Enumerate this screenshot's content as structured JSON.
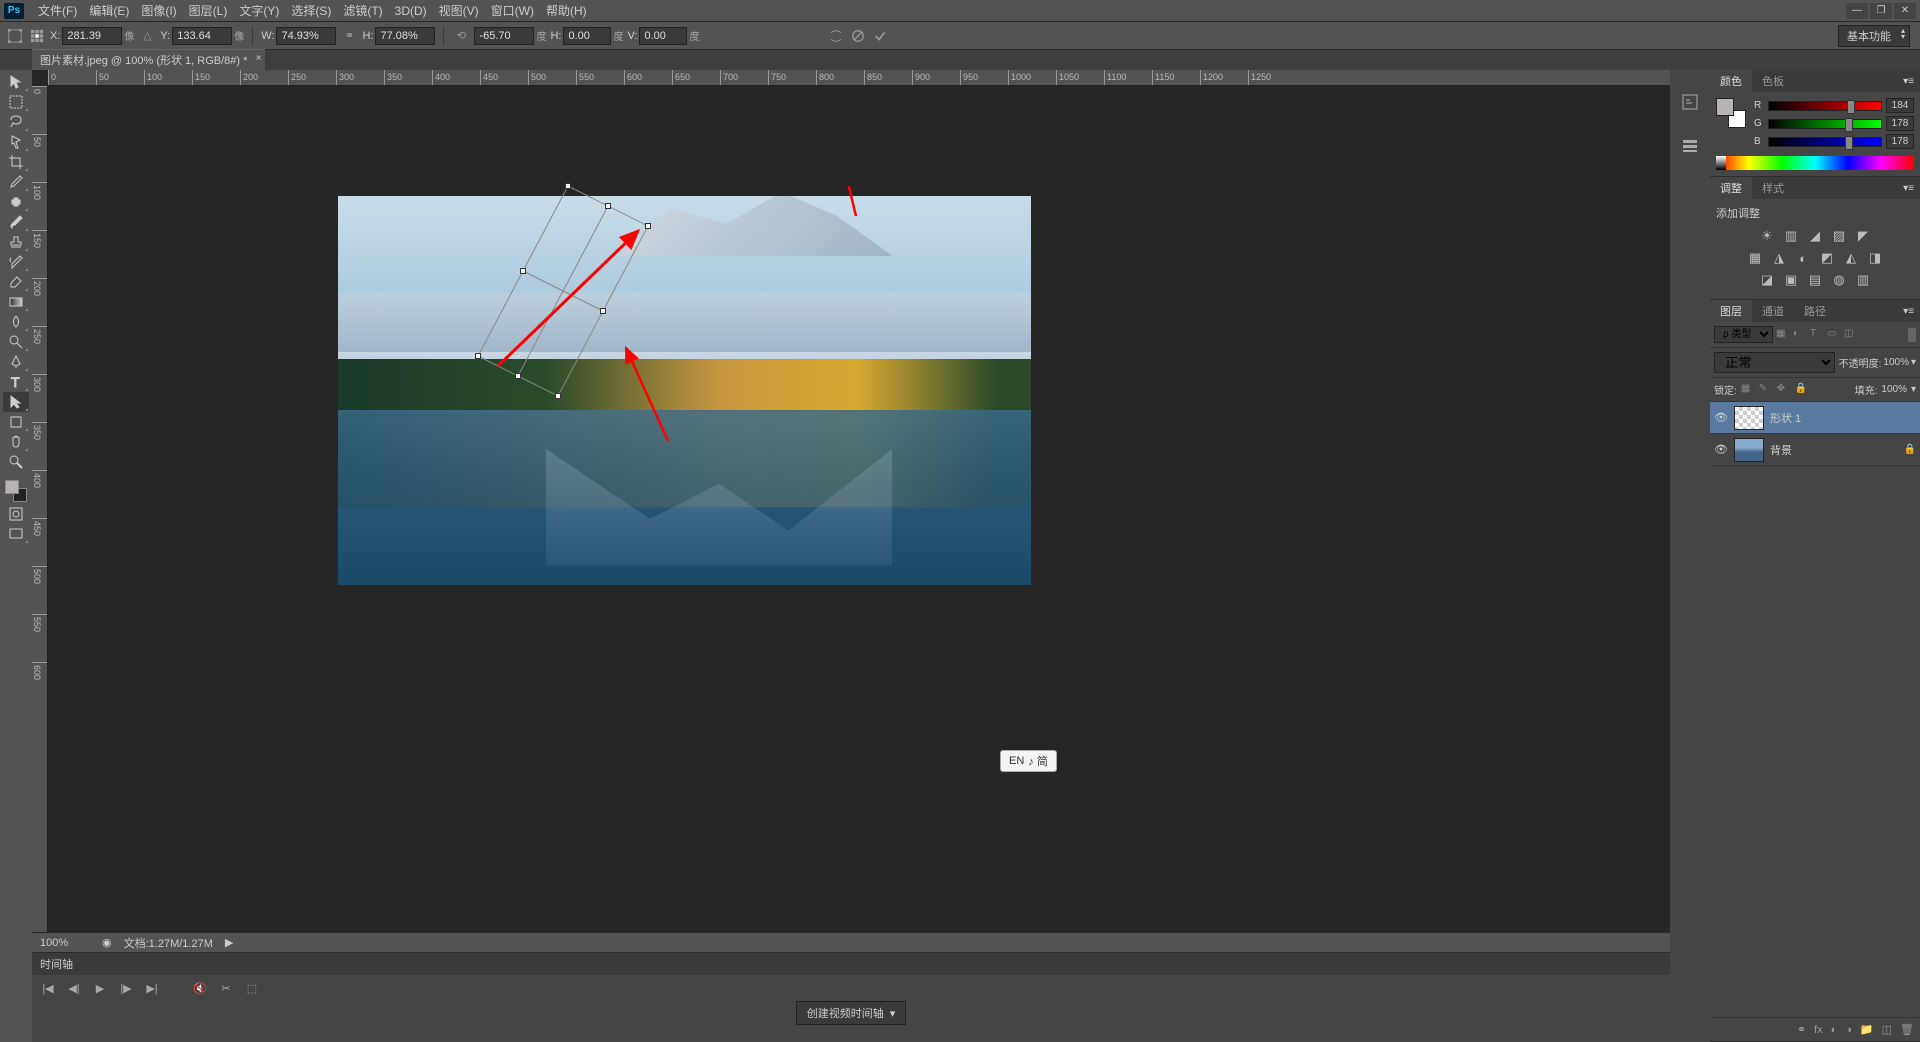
{
  "menubar": {
    "logo": "Ps",
    "items": [
      "文件(F)",
      "编辑(E)",
      "图像(I)",
      "图层(L)",
      "文字(Y)",
      "选择(S)",
      "滤镜(T)",
      "3D(D)",
      "视图(V)",
      "窗口(W)",
      "帮助(H)"
    ]
  },
  "window_controls": {
    "min": "—",
    "max": "❐",
    "close": "✕"
  },
  "options": {
    "x_label": "X:",
    "x_value": "281.39",
    "x_unit": "像",
    "y_label": "Y:",
    "y_value": "133.64",
    "y_unit": "像",
    "w_label": "W:",
    "w_value": "74.93%",
    "link": "⚭",
    "h_label": "H:",
    "h_value": "77.08%",
    "rot_label": "",
    "rot_value": "-65.70",
    "rot_unit": "度",
    "hskew_label": "H:",
    "hskew_value": "0.00",
    "hskew_unit": "度",
    "vskew_label": "V:",
    "vskew_value": "0.00",
    "vskew_unit": "度"
  },
  "workspace": "基本功能",
  "doctab": {
    "title": "图片素材.jpeg @ 100% (形状 1, RGB/8#) *"
  },
  "ruler_ticks_h": [
    "0",
    "50",
    "100",
    "150",
    "200",
    "250",
    "300",
    "350",
    "400",
    "450",
    "500",
    "550",
    "600",
    "650",
    "700",
    "750",
    "800",
    "850",
    "900",
    "950",
    "1000",
    "1050",
    "1100",
    "1150",
    "1200",
    "1250"
  ],
  "ruler_ticks_v": [
    "0",
    "50",
    "100",
    "150",
    "200",
    "250",
    "300",
    "350",
    "400",
    "450",
    "500",
    "550",
    "600"
  ],
  "status": {
    "zoom": "100%",
    "doc": "文档:1.27M/1.27M"
  },
  "timeline": {
    "tab": "时间轴",
    "create_btn": "创建视频时间轴"
  },
  "panels": {
    "color": {
      "tab1": "颜色",
      "tab2": "色板",
      "r": "R",
      "g": "G",
      "b": "B",
      "r_val": "184",
      "g_val": "178",
      "b_val": "178"
    },
    "adjust": {
      "tab1": "调整",
      "tab2": "样式",
      "label": "添加调整",
      "row1": [
        "☀",
        "▥",
        "◢",
        "▨",
        "◤"
      ],
      "row2": [
        "▦",
        "◮",
        "◐",
        "◩",
        "◭",
        "◨"
      ],
      "row3": [
        "◪",
        "▣",
        "▤",
        "◍",
        "▥"
      ]
    },
    "layers": {
      "tab1": "图层",
      "tab2": "通道",
      "tab3": "路径",
      "filter_label": "ρ 类型",
      "blend": "正常",
      "opacity_label": "不透明度:",
      "opacity_val": "100%",
      "lock_label": "锁定:",
      "fill_label": "填充:",
      "fill_val": "100%",
      "items": [
        {
          "name": "形状 1",
          "active": true,
          "thumb": "checker"
        },
        {
          "name": "背景",
          "active": false,
          "thumb": "img",
          "locked": true
        }
      ]
    }
  },
  "ime": {
    "lang": "EN",
    "mode": "♪ 简"
  }
}
